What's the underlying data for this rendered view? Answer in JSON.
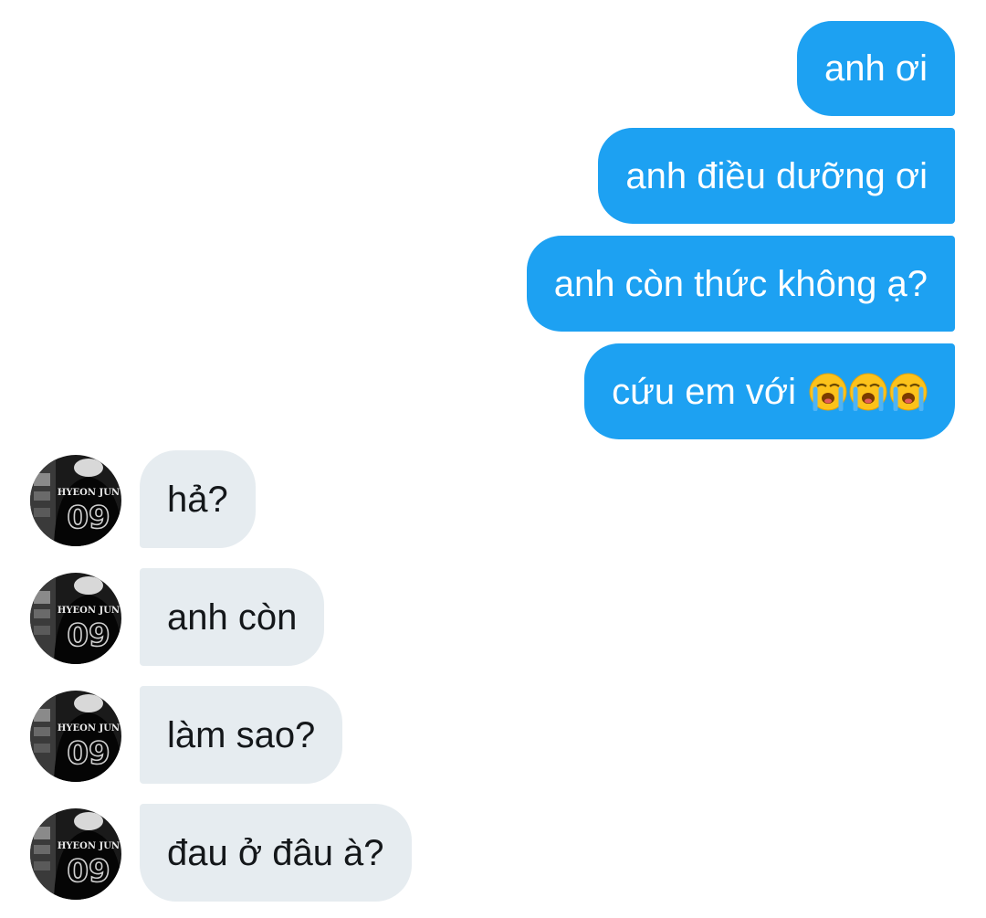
{
  "conversation": {
    "sent": [
      {
        "text": "anh ơi"
      },
      {
        "text": "anh điều dưỡng ơi"
      },
      {
        "text": "anh còn thức không ạ?"
      },
      {
        "text": "cứu em với",
        "emoji": [
          "loudly-crying-face",
          "loudly-crying-face",
          "loudly-crying-face"
        ]
      }
    ],
    "received": [
      {
        "text": "hả?",
        "avatar_text": "HYEON JUN",
        "avatar_number": "09"
      },
      {
        "text": "anh còn",
        "avatar_text": "HYEON JUN",
        "avatar_number": "09"
      },
      {
        "text": "làm sao?",
        "avatar_text": "HYEON JUN",
        "avatar_number": "09"
      },
      {
        "text": "đau ở đâu à?",
        "avatar_text": "HYEON JUN",
        "avatar_number": "09"
      }
    ]
  },
  "colors": {
    "sent_bubble": "#1da1f2",
    "received_bubble": "#e6ecf0",
    "sent_text": "#ffffff",
    "received_text": "#14171a"
  }
}
